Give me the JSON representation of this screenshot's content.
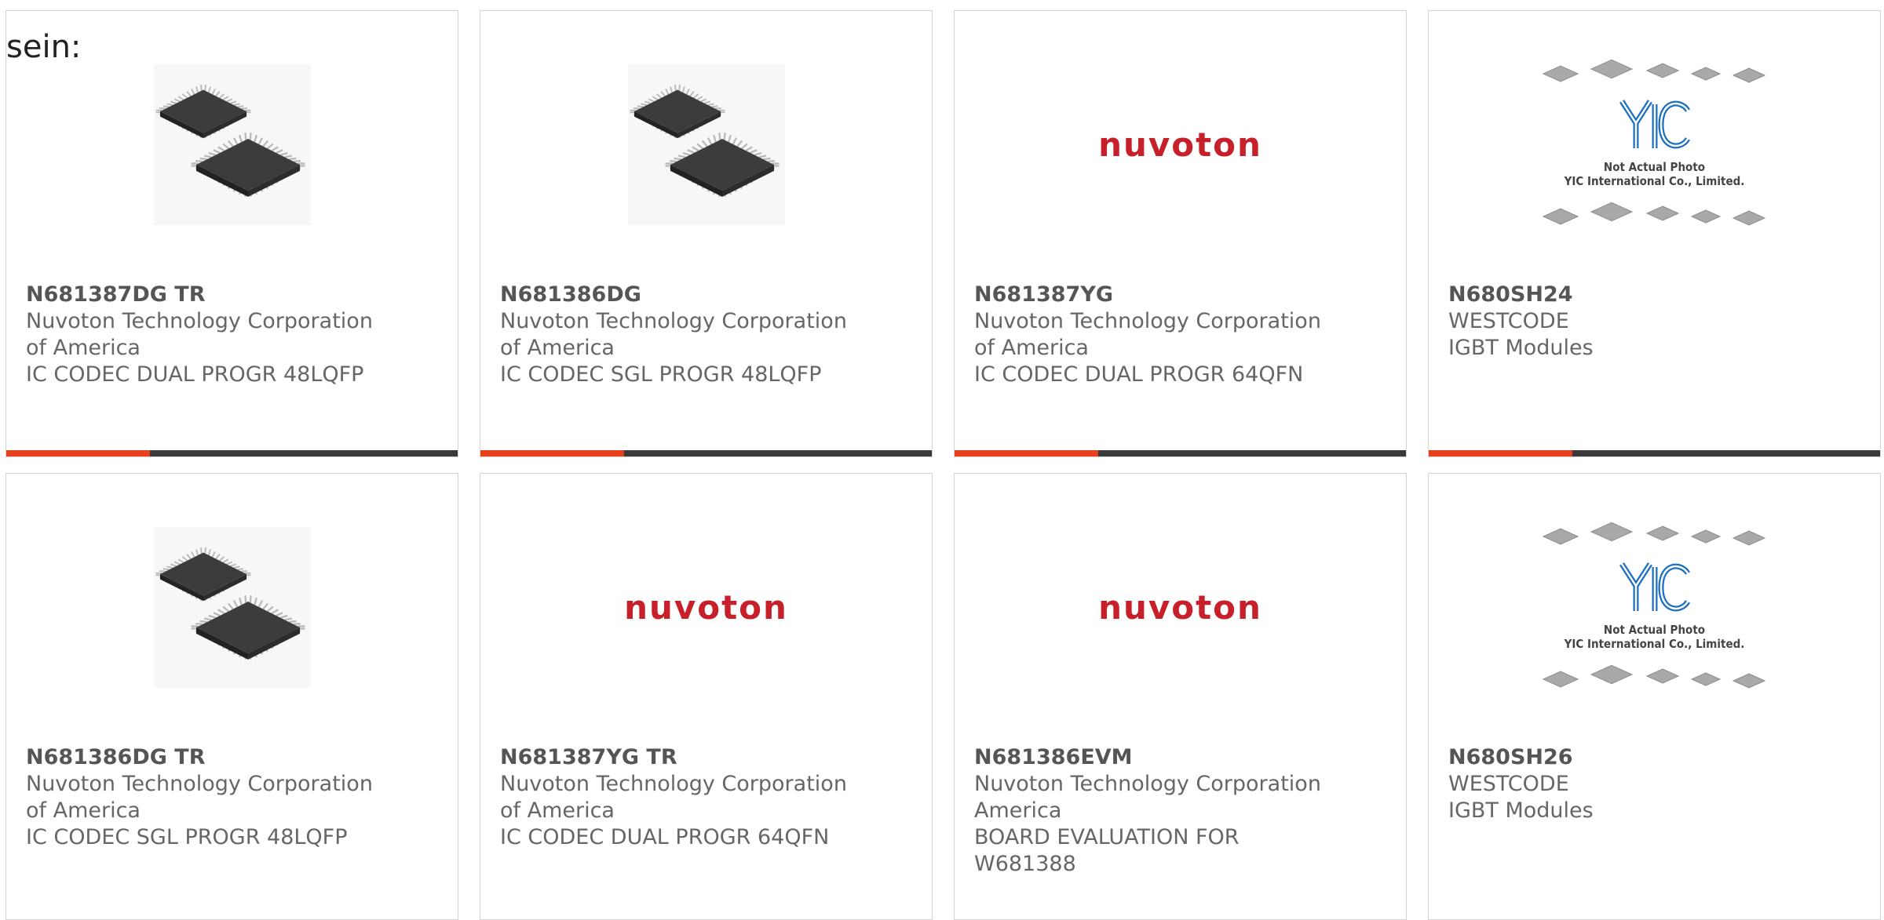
{
  "heading": "sein:",
  "products": [
    {
      "part": "N681387DG TR",
      "lines": [
        "Nuvoton Technology Corporation",
        "of America",
        "IC CODEC DUAL PROGR 48LQFP"
      ],
      "image": "qfp-chips"
    },
    {
      "part": "N681386DG",
      "lines": [
        "Nuvoton Technology Corporation",
        "of America",
        "IC CODEC SGL PROGR 48LQFP"
      ],
      "image": "qfp-chips"
    },
    {
      "part": "N681387YG",
      "lines": [
        "Nuvoton Technology Corporation",
        "of America",
        "IC CODEC DUAL PROGR 64QFN"
      ],
      "image": "nuvoton-logo"
    },
    {
      "part": "N680SH24",
      "lines": [
        "WESTCODE",
        "IGBT Modules"
      ],
      "image": "yic-placeholder"
    },
    {
      "part": "N681386DG TR",
      "lines": [
        "Nuvoton Technology Corporation",
        "of America",
        "IC CODEC SGL PROGR 48LQFP"
      ],
      "image": "qfp-chips"
    },
    {
      "part": "N681387YG TR",
      "lines": [
        "Nuvoton Technology Corporation",
        "of America",
        "IC CODEC DUAL PROGR 64QFN"
      ],
      "image": "nuvoton-logo"
    },
    {
      "part": "N681386EVM",
      "lines": [
        "Nuvoton Technology Corporation",
        "America",
        "BOARD EVALUATION FOR",
        "W681388"
      ],
      "image": "nuvoton-logo"
    },
    {
      "part": "N680SH26",
      "lines": [
        "WESTCODE",
        "IGBT Modules"
      ],
      "image": "yic-placeholder"
    }
  ],
  "nuvoton_logo_text": "nuvoTon",
  "yic_caption": [
    "Not Actual Photo",
    "YIC International Co., Limited."
  ],
  "colors": {
    "accent": "#e8401c",
    "bar": "#3a3a3a",
    "nuvoton": "#c8202a",
    "yic": "#1a6fc0"
  }
}
